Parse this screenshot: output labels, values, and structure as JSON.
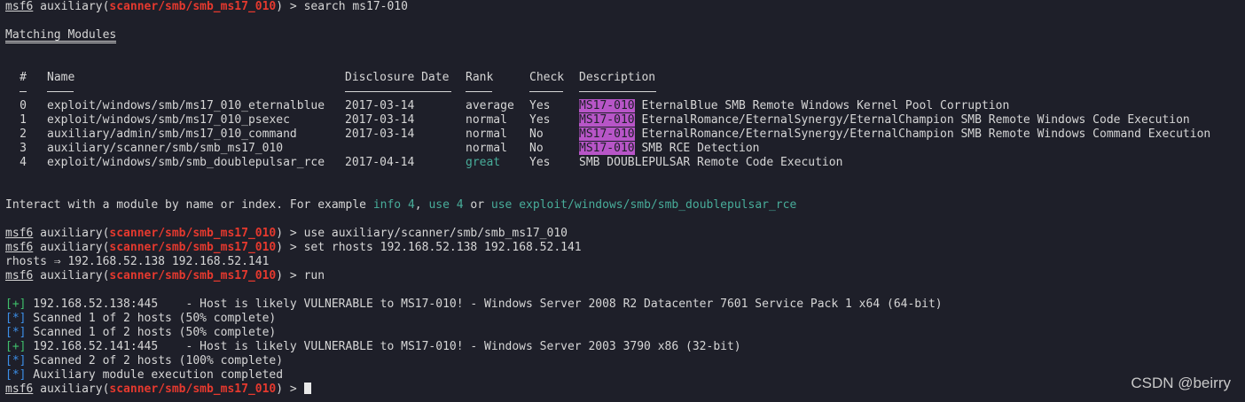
{
  "prompt": {
    "user": "msf6",
    "module_prefix": " auxiliary(",
    "module": "scanner/smb/smb_ms17_010",
    "suffix": ") > "
  },
  "commands": {
    "search": "search ms17-010",
    "use": "use auxiliary/scanner/smb/smb_ms17_010",
    "set": "set rhosts 192.168.52.138 192.168.52.141",
    "run": "run"
  },
  "matching_title": "Matching Modules",
  "table": {
    "headers": [
      "#",
      "Name",
      "Disclosure Date",
      "Rank",
      "Check",
      "Description"
    ],
    "rows": [
      {
        "num": "0",
        "name": "exploit/windows/smb/ms17_010_eternalblue",
        "date": "2017-03-14",
        "rank": "average",
        "check": "Yes",
        "tag": "MS17-010",
        "desc": " EternalBlue SMB Remote Windows Kernel Pool Corruption"
      },
      {
        "num": "1",
        "name": "exploit/windows/smb/ms17_010_psexec",
        "date": "2017-03-14",
        "rank": "normal",
        "check": "Yes",
        "tag": "MS17-010",
        "desc": " EternalRomance/EternalSynergy/EternalChampion SMB Remote Windows Code Execution"
      },
      {
        "num": "2",
        "name": "auxiliary/admin/smb/ms17_010_command",
        "date": "2017-03-14",
        "rank": "normal",
        "check": "No",
        "tag": "MS17-010",
        "desc": " EternalRomance/EternalSynergy/EternalChampion SMB Remote Windows Command Execution"
      },
      {
        "num": "3",
        "name": "auxiliary/scanner/smb/smb_ms17_010",
        "date": "",
        "rank": "normal",
        "check": "No",
        "tag": "MS17-010",
        "desc": " SMB RCE Detection"
      },
      {
        "num": "4",
        "name": "exploit/windows/smb/smb_doublepulsar_rce",
        "date": "2017-04-14",
        "rank": "great",
        "check": "Yes",
        "tag": "",
        "desc": "SMB DOUBLEPULSAR Remote Code Execution"
      }
    ]
  },
  "interact": {
    "a": "Interact with a module by name or index. For example ",
    "b": "info 4",
    "c": ", ",
    "d": "use 4",
    "e": " or ",
    "f": "use exploit/windows/smb/smb_doublepulsar_rce"
  },
  "rhosts_out": "rhosts ⇒ 192.168.52.138 192.168.52.141",
  "results": [
    {
      "mark": "[+]",
      "text": " 192.168.52.138:445    - Host is likely VULNERABLE to MS17-010! - Windows Server 2008 R2 Datacenter 7601 Service Pack 1 x64 (64-bit)"
    },
    {
      "mark": "[*]",
      "text": " Scanned 1 of 2 hosts (50% complete)"
    },
    {
      "mark": "[*]",
      "text": " Scanned 1 of 2 hosts (50% complete)"
    },
    {
      "mark": "[+]",
      "text": " 192.168.52.141:445    - Host is likely VULNERABLE to MS17-010! - Windows Server 2003 3790 x86 (32-bit)"
    },
    {
      "mark": "[*]",
      "text": " Scanned 2 of 2 hosts (100% complete)"
    },
    {
      "mark": "[*]",
      "text": " Auxiliary module execution completed"
    }
  ],
  "watermark": "CSDN @beirry",
  "colors": {
    "background": "#1e1f29",
    "module_red": "#e6392e",
    "success_green": "#3fbf6b",
    "info_blue": "#3c8fe8",
    "hint_teal": "#48ad9a",
    "highlight_purple": "#b755c7"
  }
}
